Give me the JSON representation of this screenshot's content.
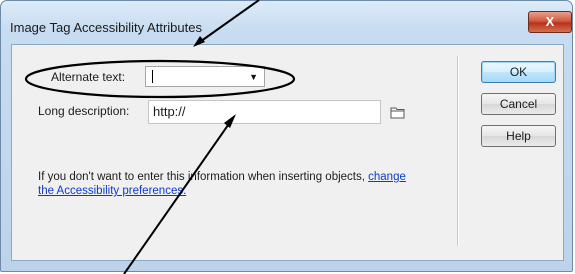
{
  "window": {
    "title": "Image Tag Accessibility Attributes",
    "close_symbol": "X"
  },
  "form": {
    "alt_label": "Alternate text:",
    "alt_value": "",
    "long_label": "Long description:",
    "long_value": "http://"
  },
  "info": {
    "text": "If you don't want to enter this information when inserting objects,",
    "link": "change the Accessibility preferences."
  },
  "buttons": {
    "ok": "OK",
    "cancel": "Cancel",
    "help": "Help"
  },
  "icons": {
    "folder": "folder-icon",
    "dropdown": "chevron-down-icon",
    "close": "close-icon"
  },
  "colors": {
    "link": "#0b3acb",
    "close_button": "#c44a31",
    "annotation": "#000000"
  }
}
